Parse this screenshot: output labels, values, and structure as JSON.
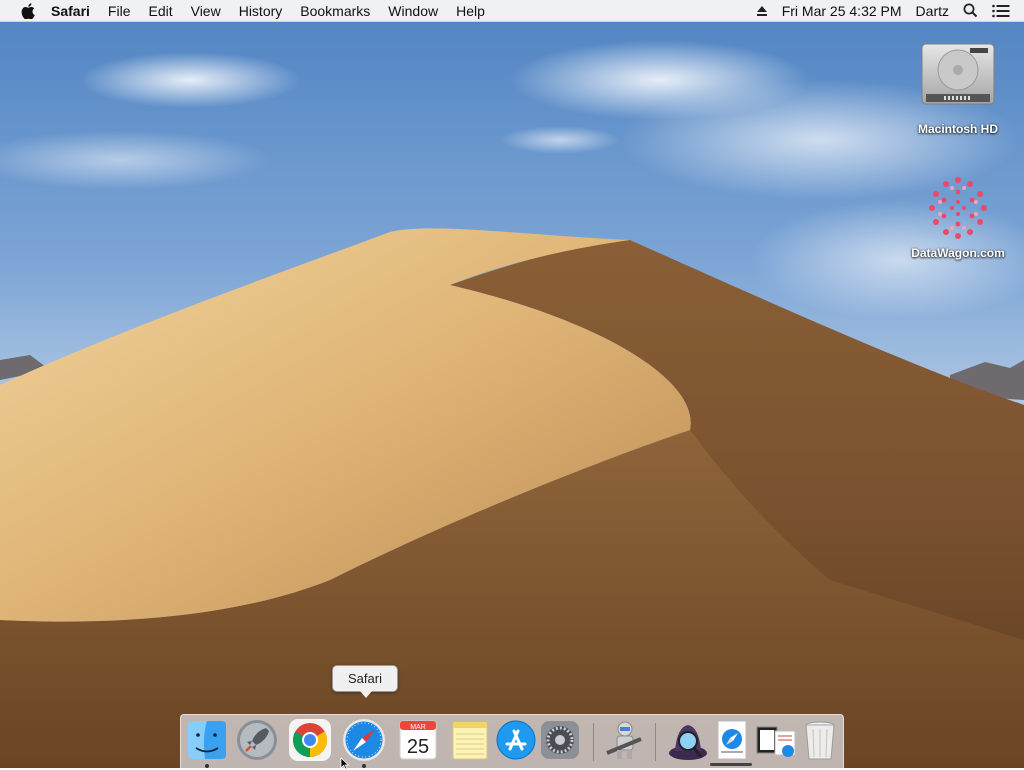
{
  "menubar": {
    "app_name": "Safari",
    "menus": [
      "File",
      "Edit",
      "View",
      "History",
      "Bookmarks",
      "Window",
      "Help"
    ],
    "datetime": "Fri Mar 25  4:32 PM",
    "user": "Dartz",
    "icons": [
      "apple-icon",
      "eject-icon",
      "spotlight-icon",
      "notification-center-icon"
    ]
  },
  "desktop": {
    "icons": [
      {
        "label": "Macintosh HD",
        "icon": "hard-drive-icon"
      },
      {
        "label": "DataWagon.com",
        "icon": "datawagon-icon"
      }
    ]
  },
  "tooltip": {
    "text": "Safari"
  },
  "dock": {
    "items": [
      {
        "name": "Finder",
        "icon": "finder-icon",
        "running": true
      },
      {
        "name": "Launchpad",
        "icon": "launchpad-icon",
        "running": false
      },
      {
        "name": "Google Chrome",
        "icon": "chrome-icon",
        "running": false
      },
      {
        "name": "Safari",
        "icon": "safari-icon",
        "running": true
      },
      {
        "name": "Calendar",
        "icon": "calendar-icon",
        "running": false,
        "month": "MAR",
        "day": "25"
      },
      {
        "name": "Notes",
        "icon": "notes-icon",
        "running": false
      },
      {
        "name": "App Store",
        "icon": "app-store-icon",
        "running": false
      },
      {
        "name": "System Preferences",
        "icon": "system-preferences-icon",
        "running": false
      },
      {
        "name": "Automator",
        "icon": "automator-icon",
        "running": false
      },
      {
        "name": "Alfred",
        "icon": "alfred-icon",
        "running": false
      },
      {
        "name": "Downloads",
        "icon": "downloads-stack-icon",
        "running": false
      },
      {
        "name": "Documents",
        "icon": "documents-stack-icon",
        "running": false
      },
      {
        "name": "Trash",
        "icon": "trash-icon",
        "running": false
      }
    ]
  },
  "colors": {
    "sky_top": "#5f8fc8",
    "sky_bottom": "#c9d9ec",
    "dune_light": "#e8c489",
    "dune_dark": "#7a5230"
  }
}
